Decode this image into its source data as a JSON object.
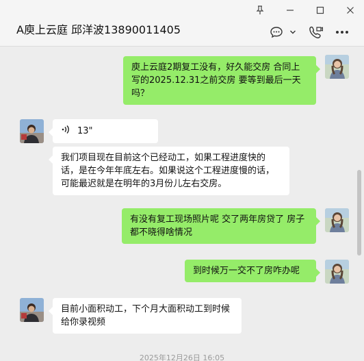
{
  "header": {
    "title": "A庾上云庭 邱洋波13890011405",
    "icons": [
      "pin-icon",
      "minimize-icon",
      "maximize-icon",
      "close-icon",
      "chat-bubble-icon",
      "chevron-down-icon",
      "video-call-icon",
      "more-icon"
    ]
  },
  "messages": [
    {
      "side": "right",
      "type": "text",
      "text": "庾上云庭2期复工没有，好久能交房 合同上写的2025.12.31之前交房 要等到最后一天吗？"
    },
    {
      "side": "left",
      "type": "voice",
      "duration": "13\""
    },
    {
      "side": "left",
      "type": "text",
      "text": "我们项目现在目前这个已经动工，如果工程进度快的话，是在今年年底左右。如果说这个工程进度慢的话，可能最迟就是在明年的3月份儿左右交房。"
    },
    {
      "side": "right",
      "type": "text",
      "text": "有没有复工现场照片呢 交了两年房贷了 房子都不晓得啥情况"
    },
    {
      "side": "right",
      "type": "text",
      "text": "到时候万一交不了房咋办呢"
    },
    {
      "side": "left",
      "type": "text",
      "text": "目前小面积动工，下个月大面积动工到时候给你录视频"
    }
  ],
  "timestamp": "2025年12月26日 16:05",
  "colors": {
    "sent_bubble": "#95ec69",
    "received_bubble": "#ffffff",
    "background": "#ededed"
  }
}
